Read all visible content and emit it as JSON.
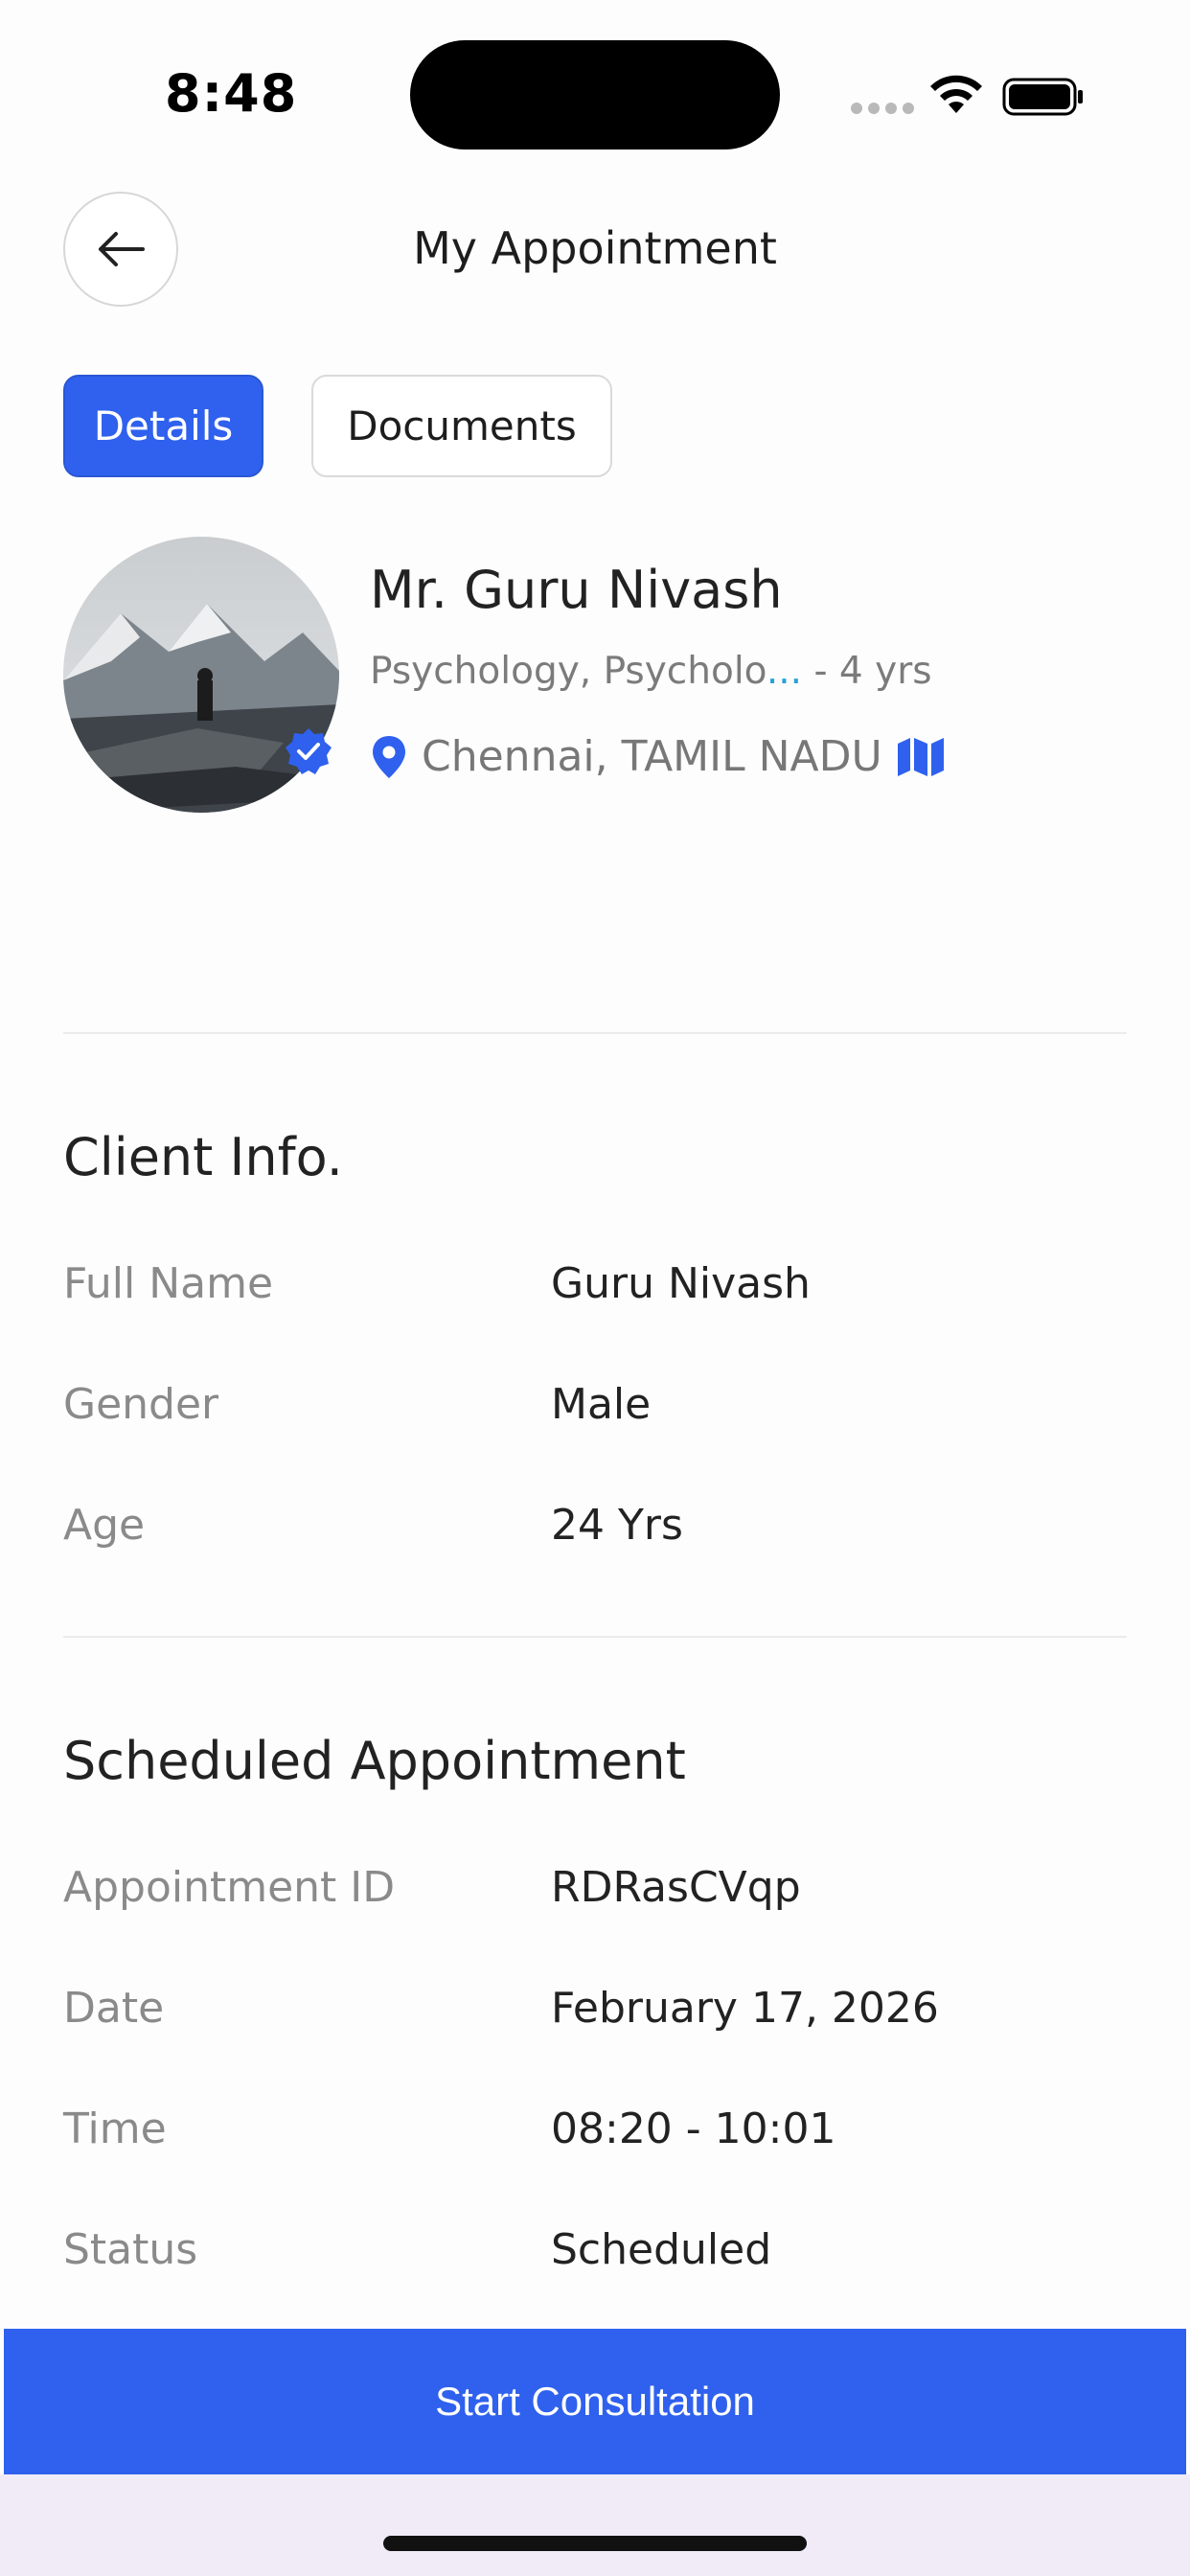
{
  "status_bar": {
    "time": "8:48"
  },
  "header": {
    "title": "My Appointment"
  },
  "tabs": [
    {
      "label": "Details",
      "active": true
    },
    {
      "label": "Documents",
      "active": false
    }
  ],
  "profile": {
    "name": "Mr. Guru Nivash",
    "specialty": "Psychology, Psycholo",
    "specialty_ellipsis": "...",
    "experience": " - 4 yrs",
    "location": "Chennai, TAMIL NADU"
  },
  "client_info": {
    "title": "Client Info.",
    "rows": [
      {
        "label": "Full Name",
        "value": "Guru Nivash"
      },
      {
        "label": "Gender",
        "value": "Male"
      },
      {
        "label": "Age",
        "value": "24 Yrs"
      }
    ]
  },
  "appointment": {
    "title": "Scheduled Appointment",
    "rows": [
      {
        "label": "Appointment ID",
        "value": "RDRasCVqp"
      },
      {
        "label": "Date",
        "value": "February 17, 2026"
      },
      {
        "label": "Time",
        "value": "08:20 - 10:01"
      },
      {
        "label": "Status",
        "value": "Scheduled"
      }
    ]
  },
  "cta": {
    "label": "Start Consultation"
  },
  "colors": {
    "accent": "#2f61ee",
    "text": "#222222",
    "muted": "#8a8a8a"
  },
  "icons": [
    "back-arrow-icon",
    "verified-icon",
    "location-pin-icon",
    "map-icon",
    "wifi-icon",
    "battery-icon",
    "signal-icon"
  ]
}
